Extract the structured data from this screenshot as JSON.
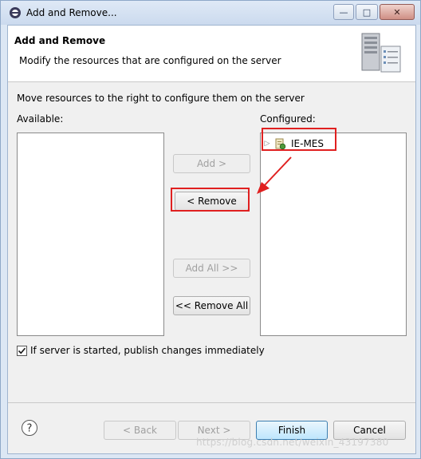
{
  "window": {
    "title": "Add and Remove...",
    "minimize_glyph": "—",
    "maximize_glyph": "□",
    "close_glyph": "✕"
  },
  "header": {
    "title": "Add and Remove",
    "subtitle": "Modify the resources that are configured on the server",
    "art_icon": "server-icon"
  },
  "instructions": "Move resources to the right to configure them on the server",
  "available": {
    "label": "Available:",
    "items": []
  },
  "configured": {
    "label": "Configured:",
    "items": [
      {
        "label": "IE-MES",
        "icon": "web-module-icon",
        "expanded": false
      }
    ]
  },
  "buttons": {
    "add": "Add >",
    "remove": "< Remove",
    "add_all": "Add All >>",
    "remove_all": "<< Remove All",
    "back": "< Back",
    "next": "Next >",
    "finish": "Finish",
    "cancel": "Cancel"
  },
  "publish_checkbox": {
    "label": "If server is started, publish changes immediately",
    "checked": true
  },
  "watermark": "https://blog.csdn.net/weixin_43197380",
  "colors": {
    "annotation_red": "#e02020",
    "default_button_border": "#3c7fb1"
  }
}
